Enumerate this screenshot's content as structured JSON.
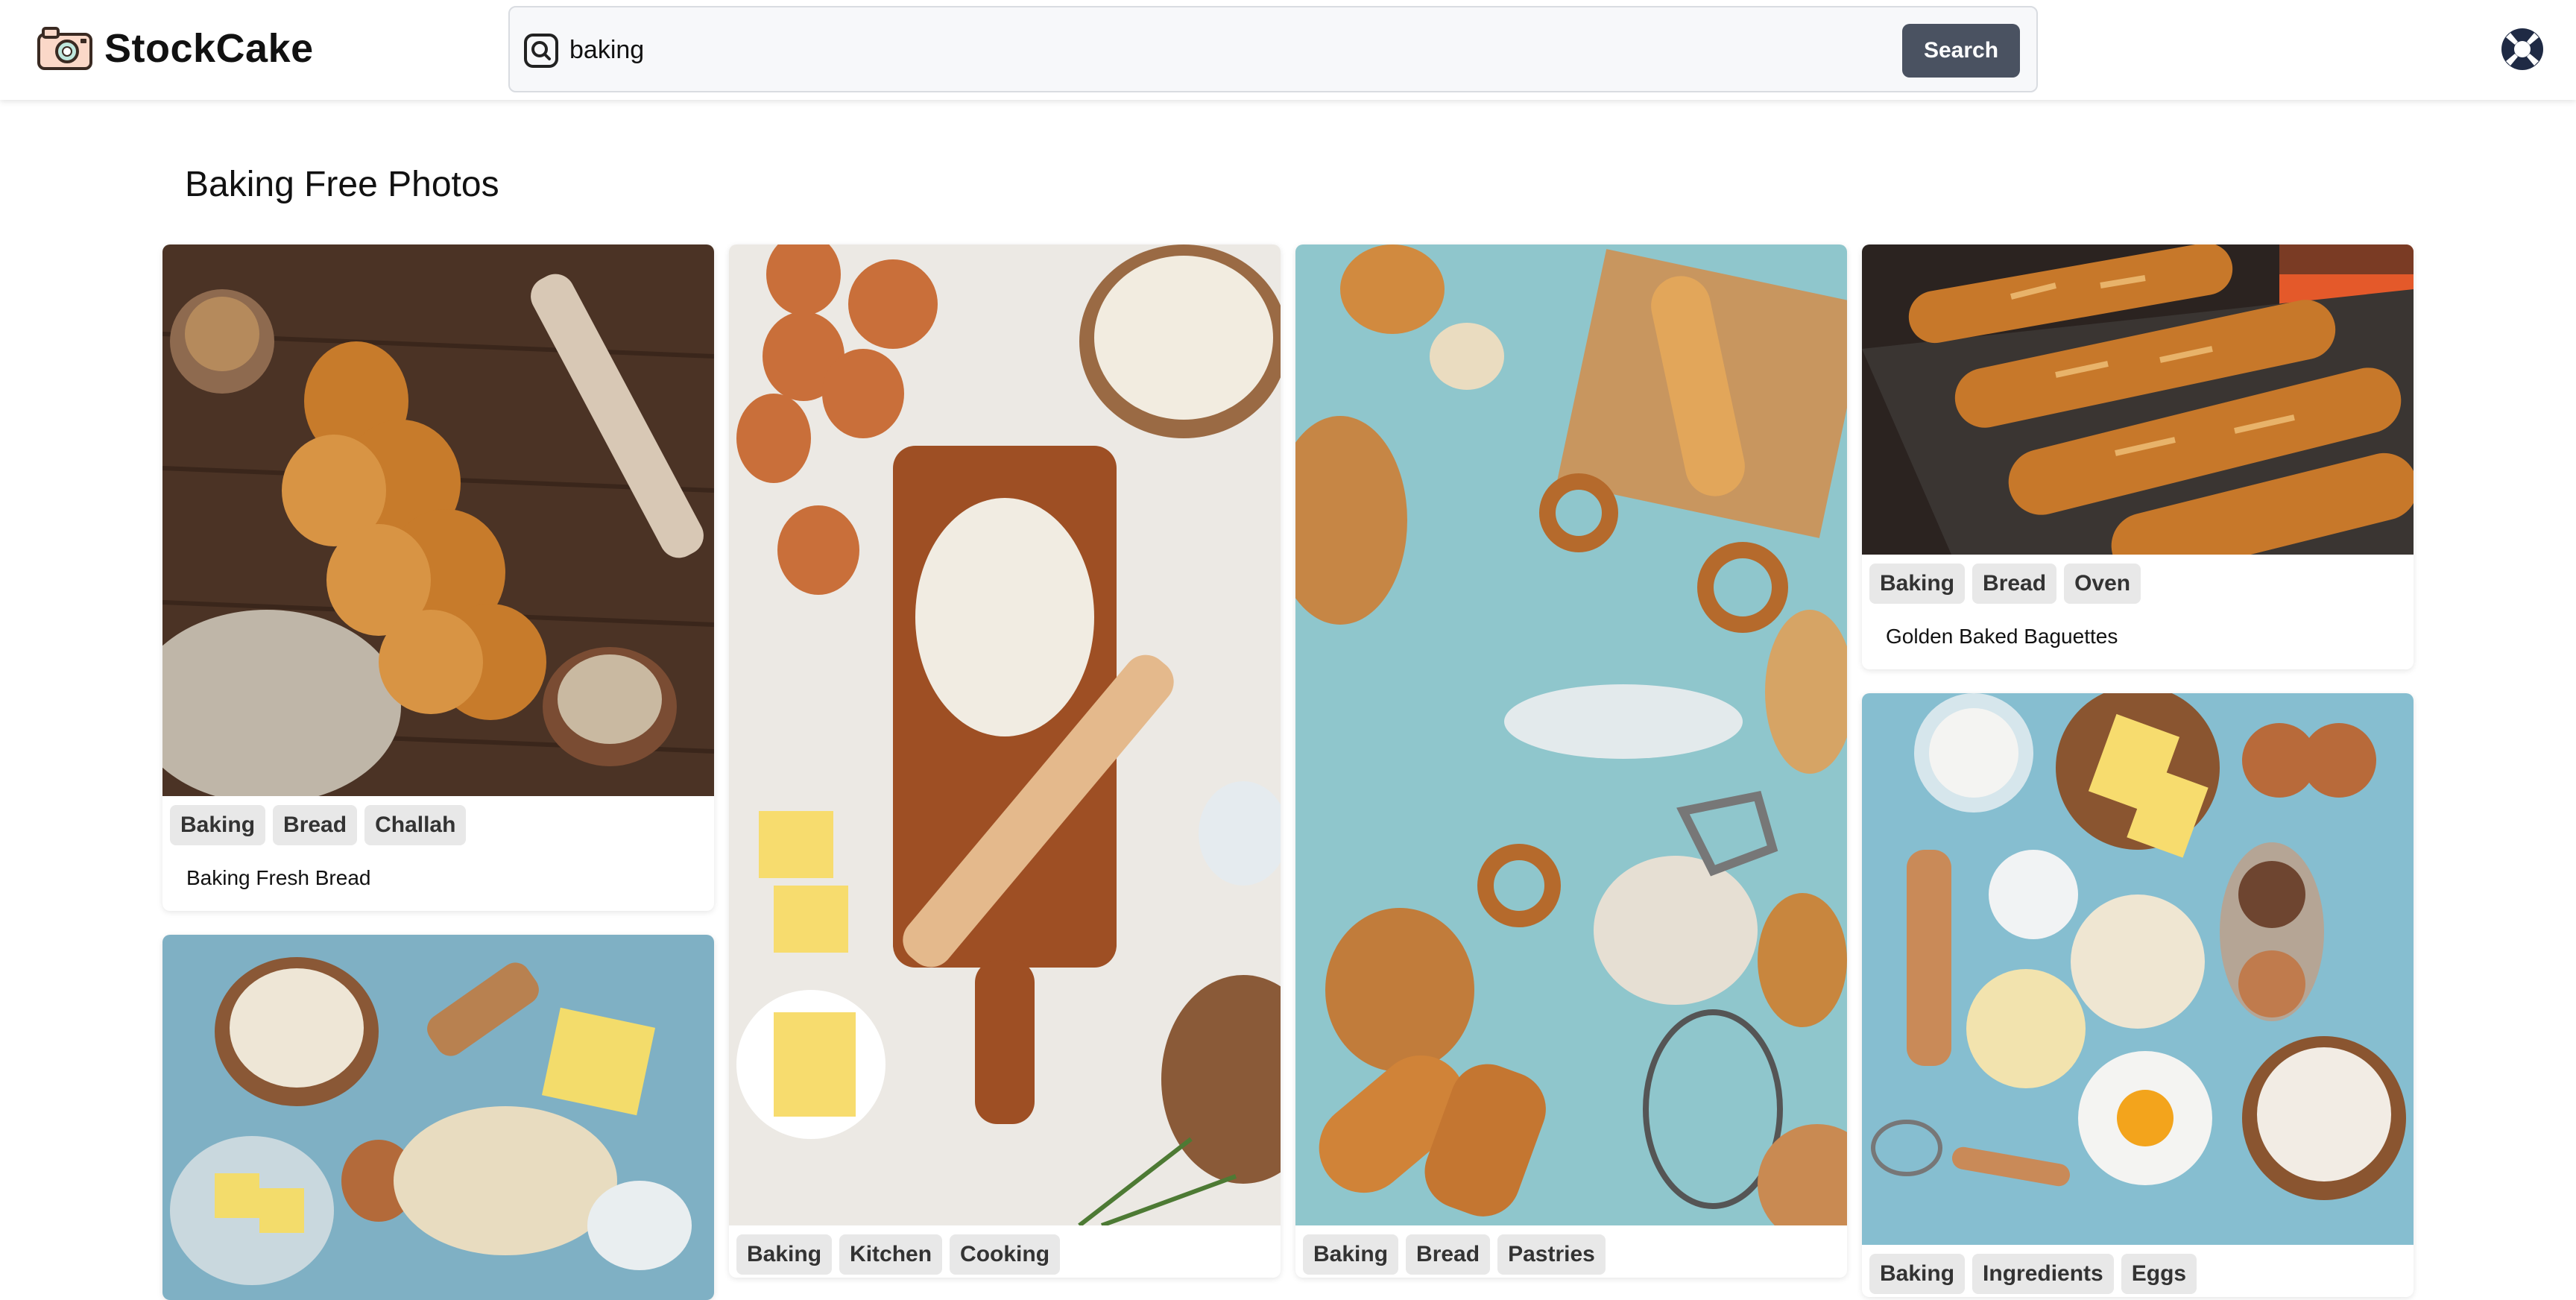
{
  "app": {
    "name": "StockCake"
  },
  "search": {
    "value": "baking",
    "placeholder": "Search",
    "button_label": "Search"
  },
  "page": {
    "title": "Baking Free Photos"
  },
  "cards": [
    {
      "tags": [
        "Baking",
        "Bread",
        "Challah"
      ],
      "caption": "Baking Fresh Bread"
    },
    {
      "tags": [],
      "caption": ""
    },
    {
      "tags": [
        "Baking",
        "Kitchen",
        "Cooking"
      ],
      "caption": ""
    },
    {
      "tags": [
        "Baking",
        "Bread",
        "Pastries"
      ],
      "caption": ""
    },
    {
      "tags": [
        "Baking",
        "Bread",
        "Oven"
      ],
      "caption": "Golden Baked Baguettes"
    },
    {
      "tags": [
        "Baking",
        "Ingredients",
        "Eggs"
      ],
      "caption": ""
    }
  ],
  "icons": {
    "logo": "camera-logo-icon",
    "search": "search-icon",
    "help": "lifebuoy-help-icon"
  },
  "colors": {
    "search_button": "#4a5261",
    "tag_bg": "#e8e8e8",
    "header_shadow": "#d9dce1"
  }
}
